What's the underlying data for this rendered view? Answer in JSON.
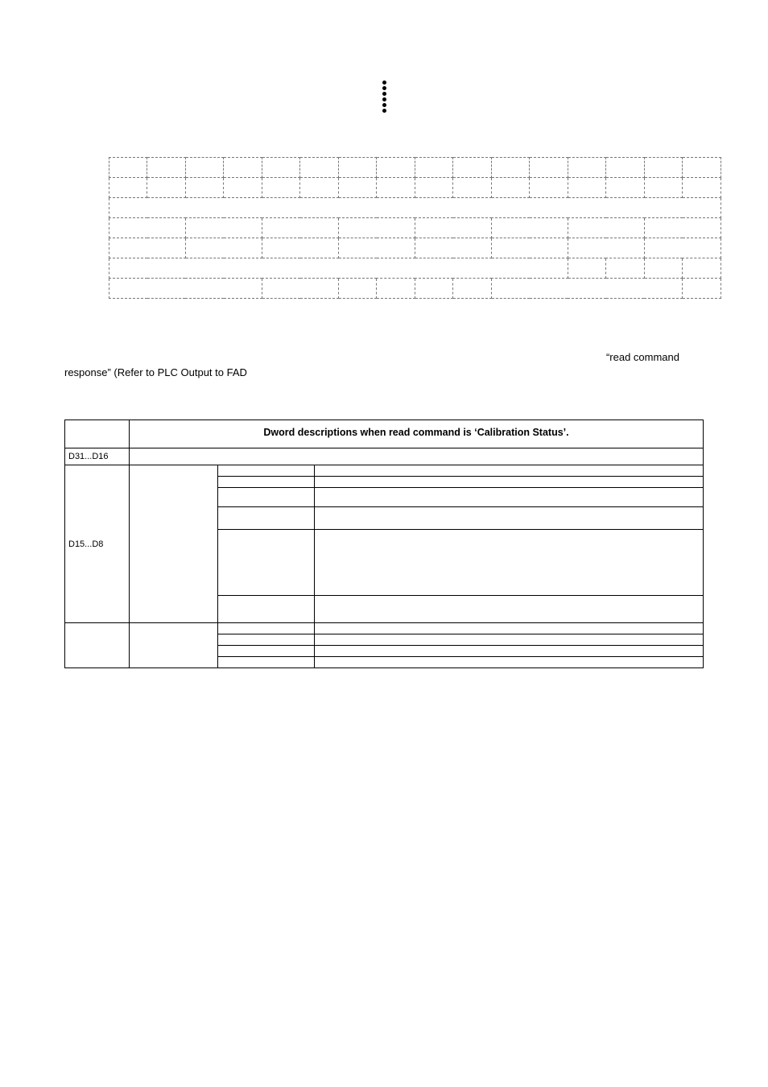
{
  "paragraph": {
    "right": "“read command",
    "left": "response” (Refer to PLC Output to FAD"
  },
  "cal_table": {
    "header": "Dword descriptions when read command is ‘Calibration Status’.",
    "rows_bits_0": "D31...D16",
    "rows_bits_1": "D15...D8"
  }
}
